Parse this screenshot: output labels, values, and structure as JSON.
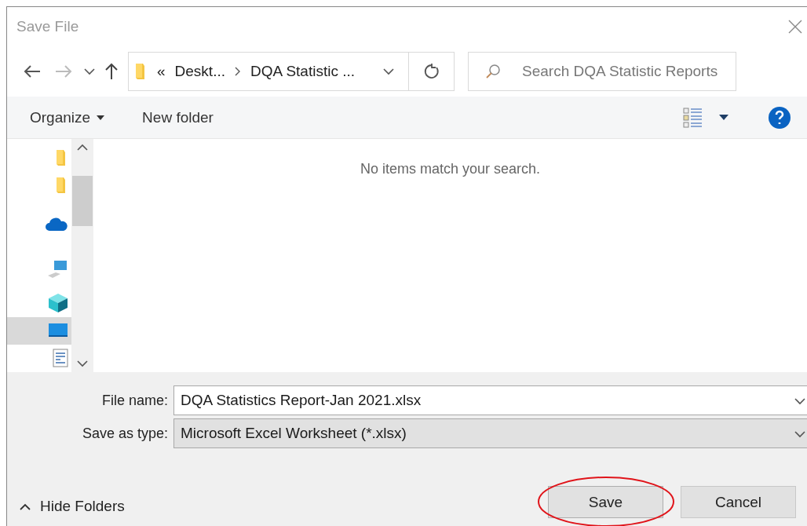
{
  "window": {
    "title": "Save File"
  },
  "nav": {
    "back_disabled": false,
    "forward_disabled": true,
    "breadcrumbs": [
      {
        "kind": "overflow",
        "label": "«"
      },
      {
        "kind": "crumb",
        "label": "Deskt..."
      },
      {
        "kind": "crumb",
        "label": "DQA Statistic ..."
      }
    ]
  },
  "search": {
    "placeholder": "Search DQA Statistic Reports"
  },
  "toolbar": {
    "organize": "Organize",
    "new_folder": "New folder"
  },
  "sidebar": {
    "items": [
      {
        "kind": "folder",
        "selected": false
      },
      {
        "kind": "folder",
        "selected": false
      },
      {
        "kind": "cloud",
        "selected": false
      },
      {
        "kind": "computer",
        "selected": false
      },
      {
        "kind": "cube",
        "selected": false
      },
      {
        "kind": "desktop",
        "selected": true
      },
      {
        "kind": "document",
        "selected": false
      }
    ]
  },
  "content": {
    "empty_message": "No items match your search."
  },
  "fields": [
    {
      "label": "File name:",
      "value": "DQA Statistics Report-Jan 2021.xlsx",
      "kind": "input"
    },
    {
      "label": "Save as type:",
      "value": "Microsoft Excel Worksheet (*.xlsx)",
      "kind": "select"
    }
  ],
  "hide_folders": "Hide Folders",
  "buttons": [
    {
      "label": "Save",
      "highlighted": true
    },
    {
      "label": "Cancel",
      "highlighted": false
    }
  ]
}
